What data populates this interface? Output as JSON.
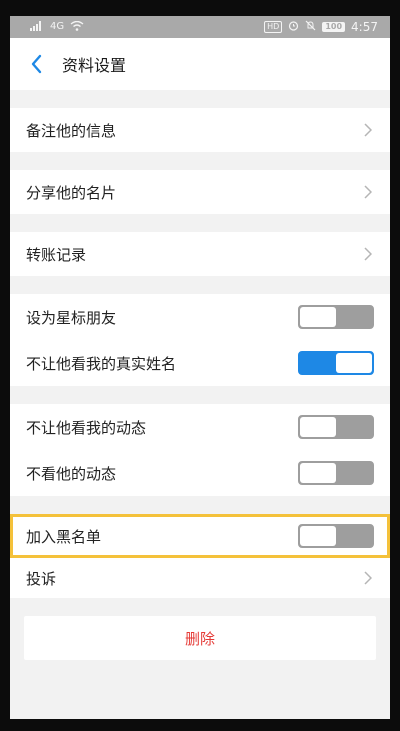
{
  "status_bar": {
    "left_icons": [
      "signal-icon",
      "wifi-icon"
    ],
    "signal_text": "4G",
    "hd_badge": "HD",
    "battery": "100",
    "time": "4:57"
  },
  "header": {
    "title": "资料设置"
  },
  "menu": {
    "remark": "备注他的信息",
    "share_card": "分享他的名片",
    "transfer_record": "转账记录",
    "star_friend": "设为星标朋友",
    "hide_real_name": "不让他看我的真实姓名",
    "hide_my_moments": "不让他看我的动态",
    "hide_his_moments": "不看他的动态",
    "blacklist": "加入黑名单",
    "complain": "投诉",
    "delete": "删除"
  },
  "toggles": {
    "star_friend": false,
    "hide_real_name": true,
    "hide_my_moments": false,
    "hide_his_moments": false,
    "blacklist": false
  },
  "colors": {
    "accent_blue": "#1e88e5",
    "delete_red": "#e53935",
    "highlight_yellow": "#f4c13a",
    "toggle_off_gray": "#9e9e9e"
  }
}
